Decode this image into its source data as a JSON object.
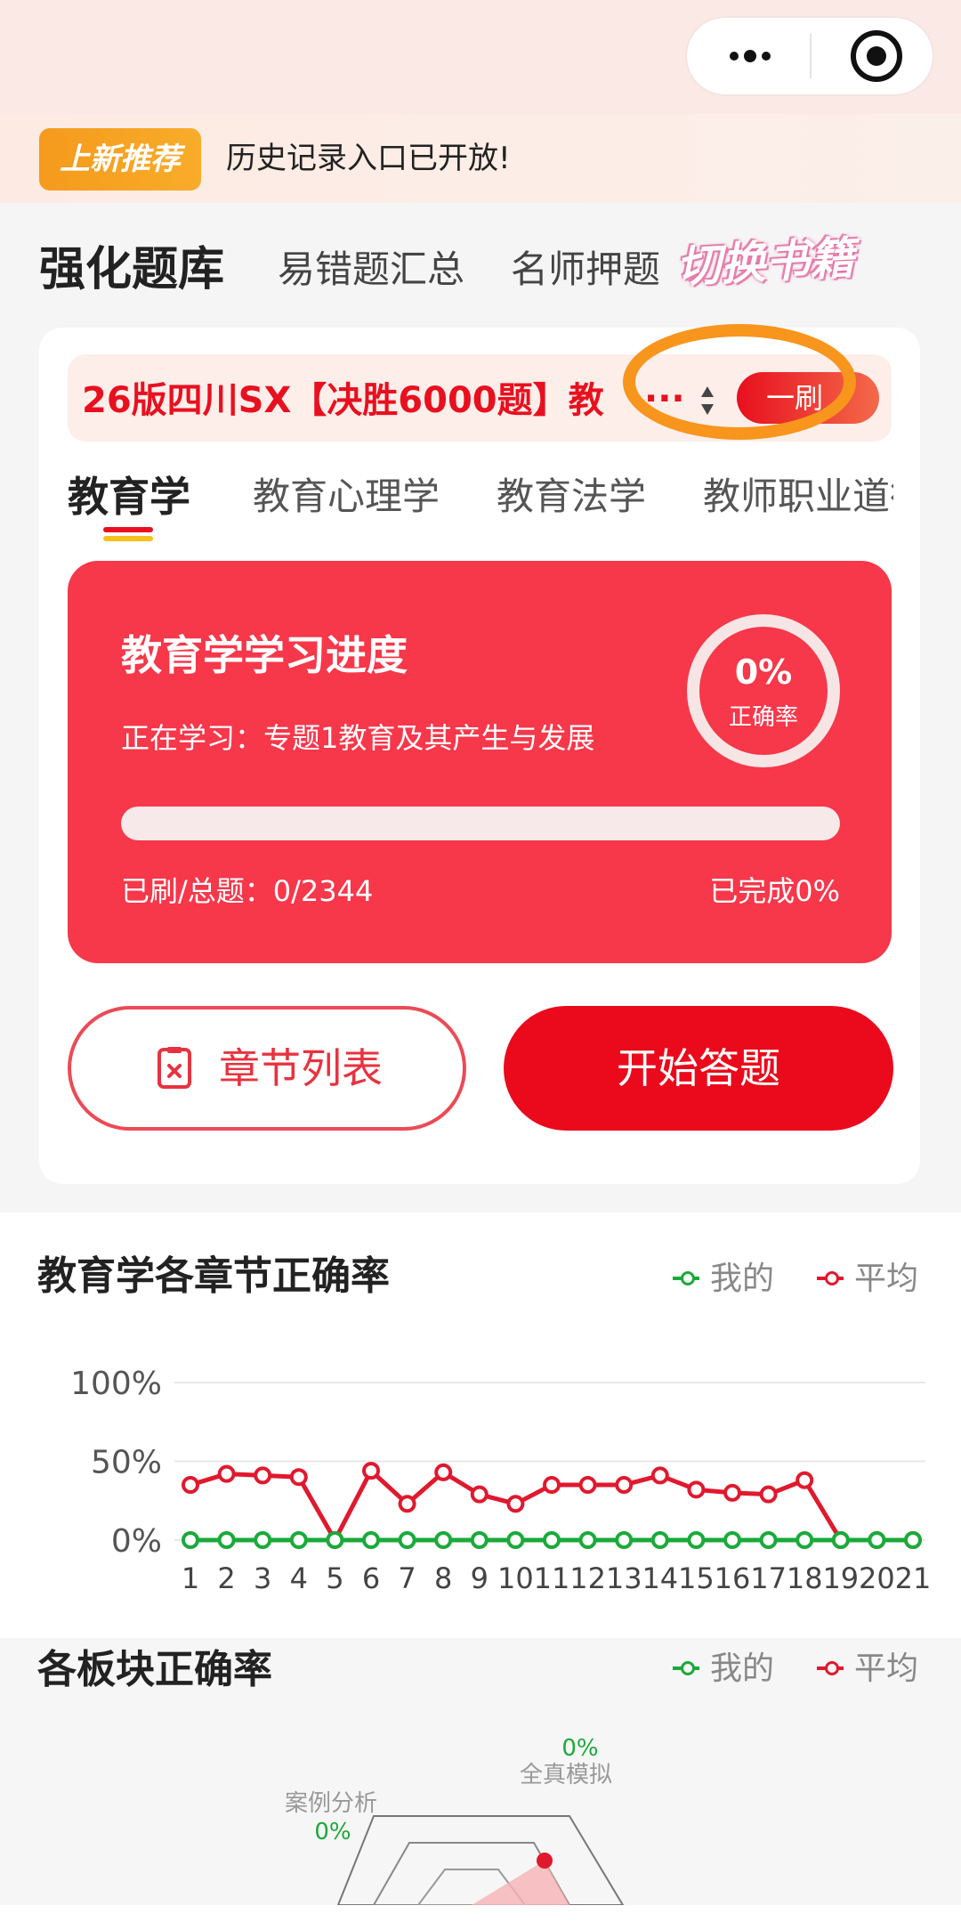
{
  "announcement": {
    "badge": "上新推荐",
    "text": "历史记录入口已开放!"
  },
  "category_tabs": [
    "强化题库",
    "易错题汇总",
    "名师押题"
  ],
  "switch_book_label": "切换书籍",
  "book": {
    "title": "26版四川SX【决胜6000题】教",
    "ellipsis": "···",
    "brush_label": "一刷"
  },
  "subject_tabs": [
    "教育学",
    "教育心理学",
    "教育法学",
    "教师职业道德"
  ],
  "progress": {
    "title": "教育学学习进度",
    "current": "正在学习：专题1教育及其产生与发展",
    "accuracy_value": "0%",
    "accuracy_label": "正确率",
    "count_text": "已刷/总题：0/2344",
    "done_text": "已完成0%",
    "completed_fraction": 0
  },
  "actions": {
    "chapters_label": "章节列表",
    "start_label": "开始答题"
  },
  "chapter_chart": {
    "title": "教育学各章节正确率",
    "legend": {
      "mine": "我的",
      "average": "平均"
    },
    "colors": {
      "mine": "#1aaa3a",
      "average": "#e0192e"
    }
  },
  "chart_data": {
    "type": "line",
    "title": "教育学各章节正确率",
    "categories": [
      "1",
      "2",
      "3",
      "4",
      "5",
      "6",
      "7",
      "8",
      "9",
      "10",
      "11",
      "12",
      "13",
      "14",
      "15",
      "16",
      "17",
      "18",
      "19",
      "20",
      "21"
    ],
    "yticks": [
      "100%",
      "50%",
      "0%"
    ],
    "ylim": [
      0,
      100
    ],
    "grid": true,
    "legend_position": "top-right",
    "series": [
      {
        "name": "我的",
        "color": "#1aaa3a",
        "values": [
          0,
          0,
          0,
          0,
          0,
          0,
          0,
          0,
          0,
          0,
          0,
          0,
          0,
          0,
          0,
          0,
          0,
          0,
          0,
          0,
          0
        ]
      },
      {
        "name": "平均",
        "color": "#e0192e",
        "values": [
          35,
          42,
          41,
          40,
          0,
          44,
          23,
          43,
          29,
          23,
          35,
          35,
          35,
          41,
          32,
          30,
          29,
          38,
          0,
          0,
          0
        ]
      }
    ]
  },
  "board_chart": {
    "title": "各板块正确率",
    "legend": {
      "mine": "我的",
      "average": "平均"
    },
    "radar_labels": [
      {
        "name": "全真模拟",
        "value": "0%"
      },
      {
        "name": "案例分析",
        "value": "0%"
      }
    ]
  }
}
